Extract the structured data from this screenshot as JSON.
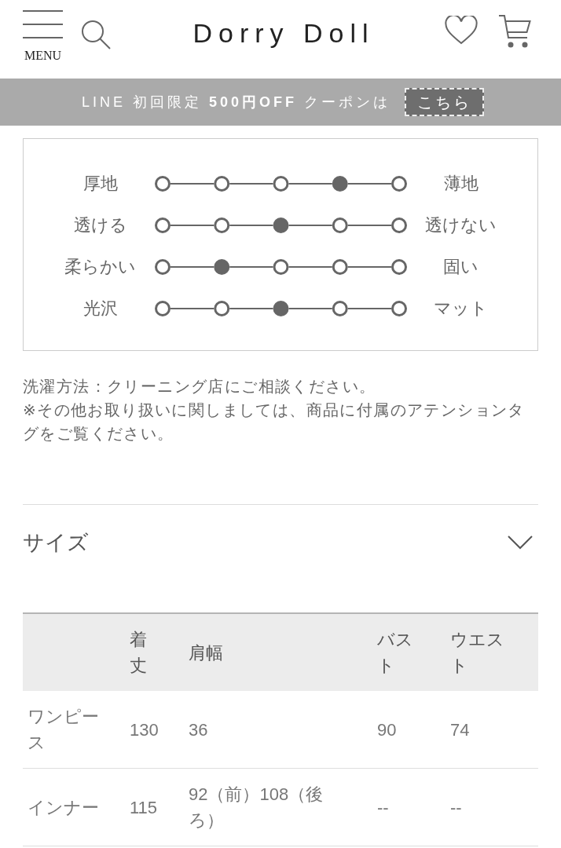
{
  "header": {
    "menu_label": "MENU",
    "logo": "Dorry Doll"
  },
  "banner": {
    "text": "LINE 初回限定 **500円OFF** クーポンは",
    "button": "こちら"
  },
  "fabric_scale": [
    {
      "left": "厚地",
      "right": "薄地",
      "points": [
        {
          "selected": false
        },
        {
          "selected": false
        },
        {
          "selected": false
        },
        {
          "selected": true
        },
        {
          "selected": false
        }
      ]
    },
    {
      "left": "透ける",
      "right": "透けない",
      "points": [
        {
          "selected": false
        },
        {
          "selected": false
        },
        {
          "selected": true
        },
        {
          "selected": false
        },
        {
          "selected": false
        }
      ]
    },
    {
      "left": "柔らかい",
      "right": "固い",
      "points": [
        {
          "selected": false
        },
        {
          "selected": true
        },
        {
          "selected": false
        },
        {
          "selected": false
        },
        {
          "selected": false
        }
      ]
    },
    {
      "left": "光沢",
      "right": "マット",
      "points": [
        {
          "selected": false
        },
        {
          "selected": false
        },
        {
          "selected": true
        },
        {
          "selected": false
        },
        {
          "selected": false
        }
      ]
    }
  ],
  "care_notes": [
    "洗濯方法：クリーニング店にご相談ください。",
    "※その他お取り扱いに関しましては、商品に付属のアテンションタグをご覧ください。"
  ],
  "size_section": {
    "title": "サイズ",
    "table": {
      "columns": [
        "着丈",
        "肩幅",
        "バスト",
        "ウエスト"
      ],
      "rows": [
        {
          "name": "ワンピース",
          "values": [
            "130",
            "36",
            "90",
            "74"
          ]
        },
        {
          "name": "インナー",
          "values": [
            "115",
            "92（前）108（後ろ）",
            "--",
            "--"
          ]
        }
      ]
    }
  }
}
